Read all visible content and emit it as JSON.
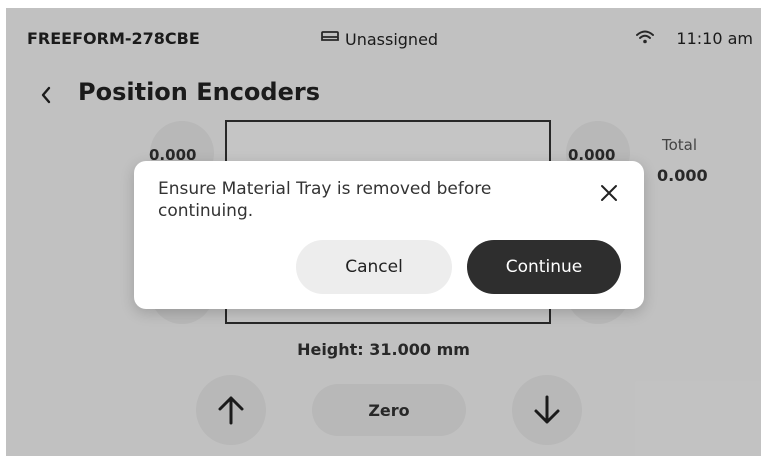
{
  "status": {
    "device_name": "FREEFORM-278CBE",
    "assignment": "Unassigned",
    "time": "11:10 am",
    "icons": {
      "tray": "tray-icon",
      "wifi": "wifi-icon"
    }
  },
  "header": {
    "back_icon": "chevron-left-icon",
    "title": "Position Encoders"
  },
  "encoders": {
    "left_value": "0.000",
    "right_value": "0.000",
    "total_label": "Total",
    "total_value": "0.000"
  },
  "height_text": "Height: 31.000 mm",
  "controls": {
    "up_icon": "arrow-up-icon",
    "zero_label": "Zero",
    "down_icon": "arrow-down-icon"
  },
  "dialog": {
    "message": "Ensure Material Tray is removed before continuing.",
    "close_icon": "close-icon",
    "cancel_label": "Cancel",
    "continue_label": "Continue"
  },
  "colors": {
    "background": "#f2f2f2",
    "overlay": "rgba(0,0,0,0.2)",
    "primary_button": "#2e2e2e",
    "secondary_button": "#ededed"
  }
}
